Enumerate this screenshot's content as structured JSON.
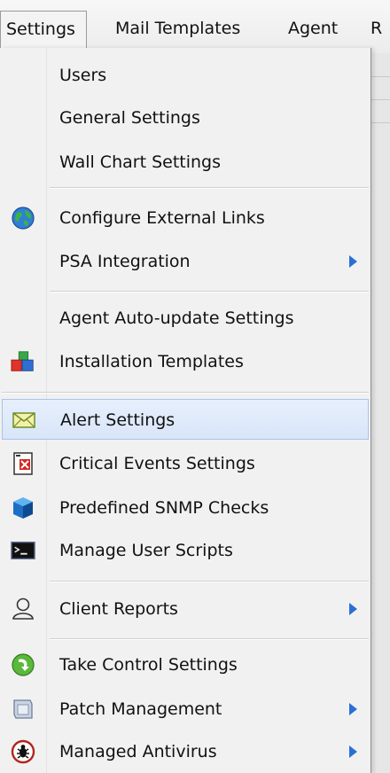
{
  "menubar": {
    "items": [
      {
        "label": "Settings"
      },
      {
        "label": "Mail Templates"
      },
      {
        "label": "Agent"
      },
      {
        "label": "R"
      }
    ]
  },
  "menu": {
    "items": [
      {
        "label": "Users",
        "icon": "none"
      },
      {
        "label": "General Settings",
        "icon": "none"
      },
      {
        "label": "Wall Chart Settings",
        "icon": "none"
      },
      {
        "label": "Configure External Links",
        "icon": "globe-icon"
      },
      {
        "label": "PSA Integration",
        "icon": "none",
        "submenu": true
      },
      {
        "label": "Agent Auto-update Settings",
        "icon": "none"
      },
      {
        "label": "Installation Templates",
        "icon": "blocks-icon"
      },
      {
        "label": "Alert Settings",
        "icon": "envelope-icon",
        "highlighted": true
      },
      {
        "label": "Critical Events Settings",
        "icon": "critical-events-icon"
      },
      {
        "label": "Predefined SNMP Checks",
        "icon": "cube-icon"
      },
      {
        "label": "Manage User Scripts",
        "icon": "terminal-icon"
      },
      {
        "label": "Client Reports",
        "icon": "person-icon",
        "submenu": true
      },
      {
        "label": "Take Control Settings",
        "icon": "take-control-icon"
      },
      {
        "label": "Patch Management",
        "icon": "patch-icon",
        "submenu": true
      },
      {
        "label": "Managed Antivirus",
        "icon": "antivirus-bug-icon",
        "submenu": true
      }
    ]
  },
  "colors": {
    "highlight": "#dbe7f9",
    "submenu_arrow": "#2b6fd6"
  }
}
